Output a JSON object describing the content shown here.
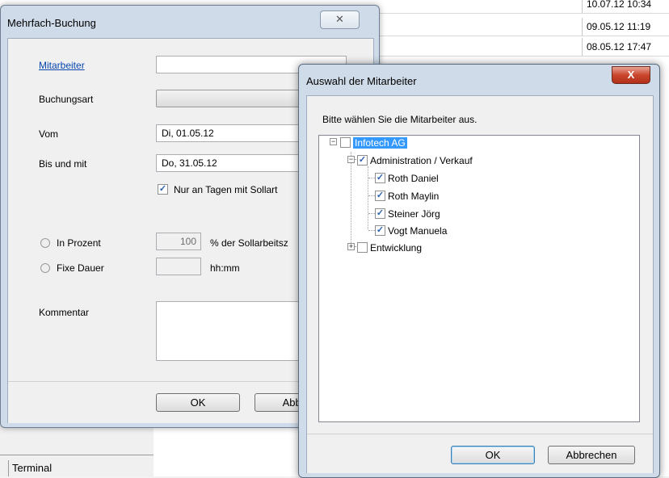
{
  "background": {
    "times": [
      "10.07.12 10:34",
      "09.05.12 11:19",
      "08.05.12 17:47"
    ],
    "terminal_label": "Terminal"
  },
  "mehrfach": {
    "title": "Mehrfach-Buchung",
    "close_glyph": "✕",
    "mitarbeiter_label": "Mitarbeiter",
    "mitarbeiter_value": "",
    "buchungsart_label": "Buchungsart",
    "vom_label": "Vom",
    "vom_value": "Di, 01.05.12",
    "bis_label": "Bis und mit",
    "bis_value": "Do, 31.05.12",
    "nur_tagen_label": "Nur an Tagen mit Sollart",
    "nur_tagen_checked": true,
    "in_prozent_label": "In Prozent",
    "prozent_value": "100",
    "prozent_suffix": "% der Sollarbeitsz",
    "fixe_dauer_label": "Fixe Dauer",
    "dauer_value": "",
    "dauer_suffix": "hh:mm",
    "kommentar_label": "Kommentar",
    "ok_label": "OK",
    "abbrechen_label": "Abbre"
  },
  "auswahl": {
    "title": "Auswahl der Mitarbeiter",
    "close_glyph": "X",
    "instruction": "Bitte wählen Sie die Mitarbeiter aus.",
    "tree": {
      "root": "Infotech AG",
      "group1": "Administration / Verkauf",
      "members": [
        "Roth Daniel",
        "Roth Maylin",
        "Steiner Jörg",
        "Vogt Manuela"
      ],
      "group2": "Entwicklung"
    },
    "ok_label": "OK",
    "abbrechen_label": "Abbrechen"
  }
}
